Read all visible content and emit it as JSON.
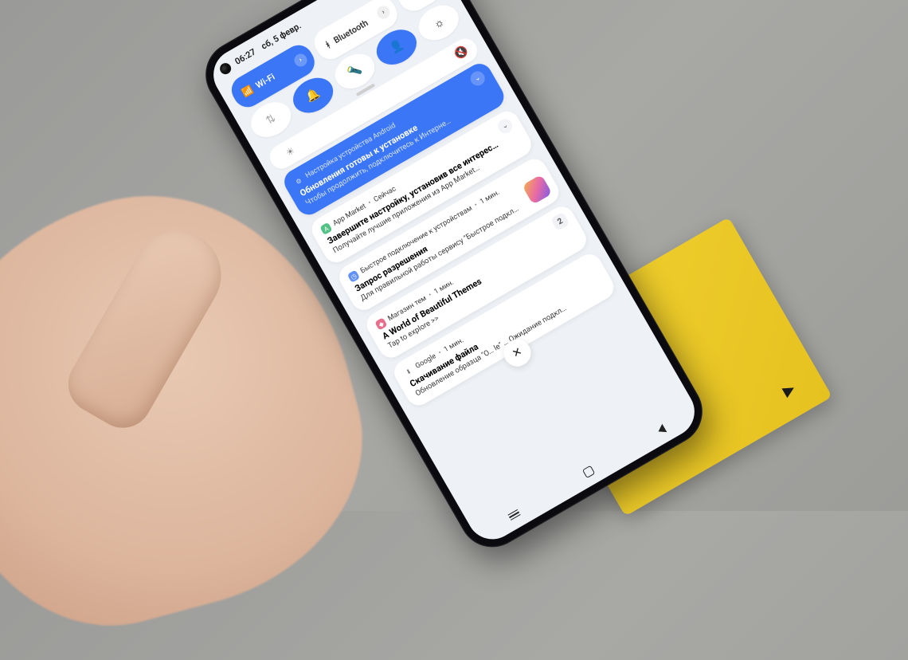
{
  "statusbar": {
    "time": "06:27",
    "date": "сб, 5 февр."
  },
  "quick_settings": {
    "wifi": {
      "label": "Wi-Fi",
      "active": true
    },
    "bluetooth": {
      "label": "Bluetooth",
      "active": false
    },
    "airplane": {
      "active": false
    },
    "mobile_data": {
      "active": false
    },
    "dnd": {
      "active": true
    },
    "flashlight": {
      "active": false
    },
    "dark_mode": {
      "active": true
    },
    "brightness_auto": {
      "active": false
    }
  },
  "mute_icon": "🔇",
  "notifications": [
    {
      "app": "Настройка устройства Android",
      "app_prefix_icon": "⚙",
      "title": "Обновления готовы к установке",
      "body": "Чтобы продолжить, подключитесь к Интерне…",
      "style": "blue"
    },
    {
      "app": "App Market",
      "time": "Сейчас",
      "title": "Завершите настройку, установив все интерес…",
      "body": "Получайте лучшие приложения из App Market…",
      "app_color": "#28b36a"
    },
    {
      "app": "Быстрое подключение к устройствам",
      "time": "1 мин.",
      "title": "Запрос разрешения",
      "body": "Для правильной работы сервису \"Быстрое подкл…",
      "app_color": "#3b76f6",
      "has_side_icon": true
    },
    {
      "app": "Магазин тем",
      "time": "1 мин.",
      "title": "A World of Beautiful Themes",
      "body": "Tap to explore >>",
      "app_color": "#e34b6e",
      "count": "2"
    },
    {
      "app": "Google",
      "time": "1 мин.",
      "title": "Скачивание файла",
      "body": "Обновление образца \"О…     le\" … Ожидание подкл…",
      "app_prefix_icon": "⬇",
      "app_color": "#777"
    }
  ],
  "clear_label": "✕"
}
